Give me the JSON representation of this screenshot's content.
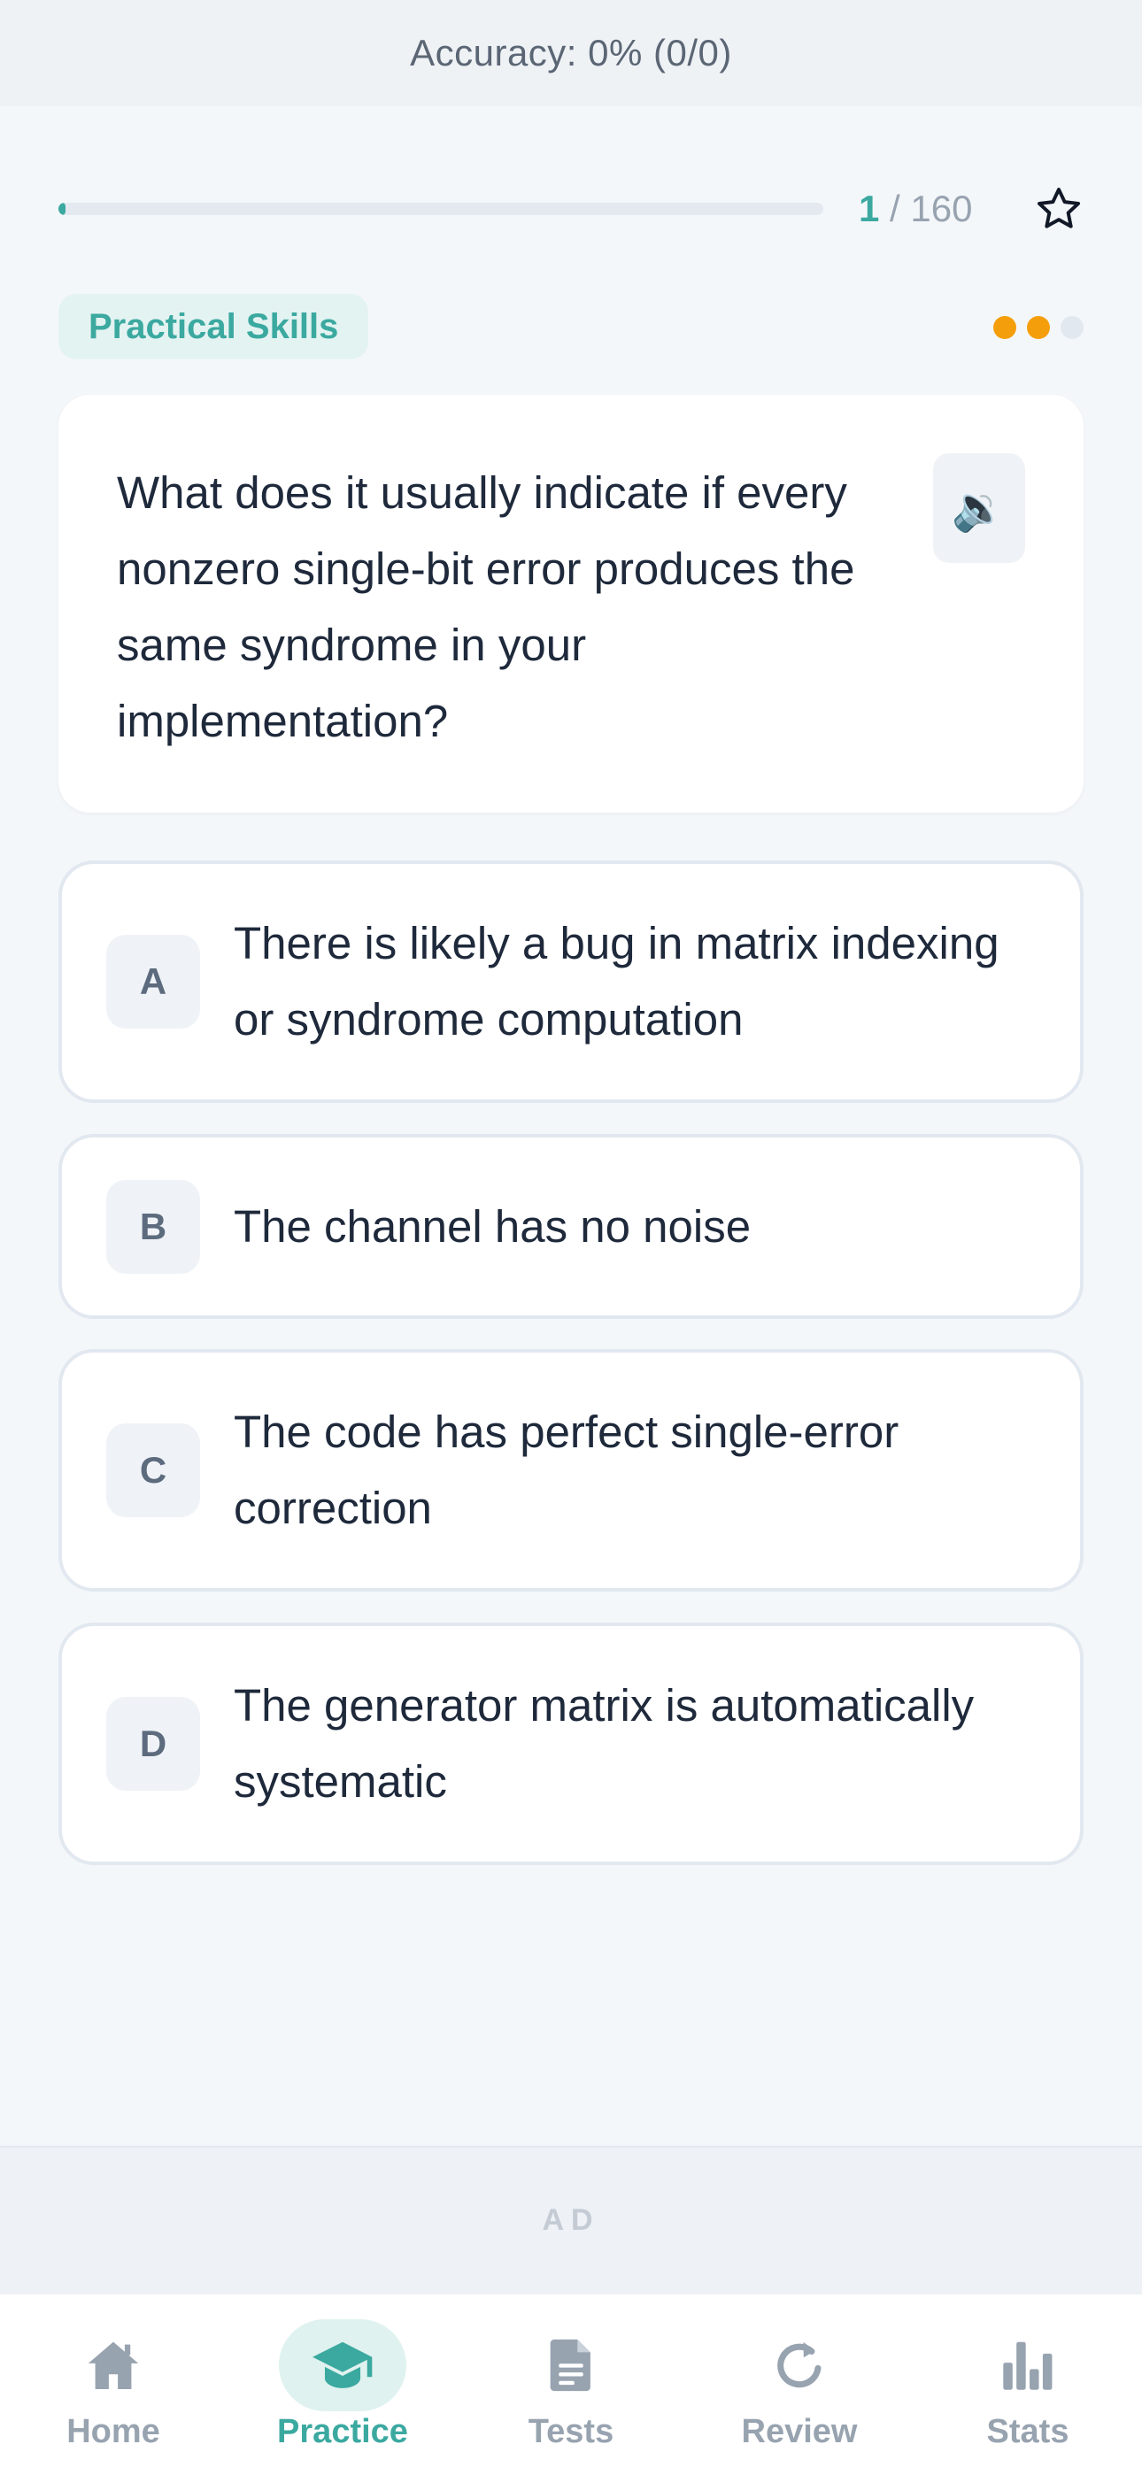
{
  "header": {
    "accuracy_text": "Accuracy: 0% (0/0)"
  },
  "progress": {
    "current": "1",
    "separator_total": " / 160",
    "fraction": 0.00625
  },
  "question": {
    "category": "Practical Skills",
    "difficulty_filled": 2,
    "difficulty_total": 3,
    "text": "What does it usually indicate if every nonzero single-bit error produces the same syndrome in your implementation?",
    "speaker_glyph": "🔉"
  },
  "options": [
    {
      "letter": "A",
      "text": "There is likely a bug in matrix indexing or syndrome computation"
    },
    {
      "letter": "B",
      "text": "The channel has no noise"
    },
    {
      "letter": "C",
      "text": "The code has perfect single-error correction"
    },
    {
      "letter": "D",
      "text": "The generator matrix is automatically systematic"
    }
  ],
  "ad": {
    "label": "AD"
  },
  "nav": {
    "items": [
      {
        "label": "Home",
        "icon": "home-icon",
        "active": false
      },
      {
        "label": "Practice",
        "icon": "graduation-cap-icon",
        "active": true
      },
      {
        "label": "Tests",
        "icon": "document-icon",
        "active": false
      },
      {
        "label": "Review",
        "icon": "refresh-icon",
        "active": false
      },
      {
        "label": "Stats",
        "icon": "bar-chart-icon",
        "active": false
      }
    ]
  },
  "colors": {
    "accent": "#3ba9a0",
    "difficulty_on": "#f59e0b",
    "difficulty_off": "#e2e8f0",
    "nav_inactive": "#98a3b0"
  }
}
